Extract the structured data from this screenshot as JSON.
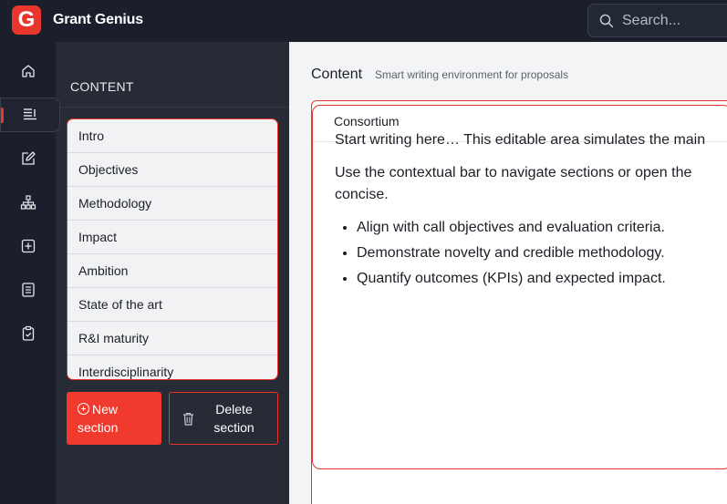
{
  "app": {
    "name": "Grant Genius",
    "logo_letter": "G"
  },
  "search": {
    "placeholder": "Search..."
  },
  "rail": {
    "items": [
      {
        "icon": "home-icon"
      },
      {
        "icon": "content-icon",
        "active": true
      },
      {
        "icon": "edit-icon"
      },
      {
        "icon": "org-chart-icon"
      },
      {
        "icon": "add-box-icon"
      },
      {
        "icon": "document-list-icon"
      },
      {
        "icon": "clipboard-check-icon"
      }
    ]
  },
  "panel": {
    "title": "CONTENT",
    "sections": [
      "Intro",
      "Objectives",
      "Methodology",
      "Impact",
      "Ambition",
      "State of the art",
      "R&I maturity",
      "Interdisciplinarity"
    ],
    "new_button": {
      "line1": "New",
      "line2": "section"
    },
    "delete_button": {
      "line1": "Delete",
      "line2": "section"
    }
  },
  "main": {
    "title": "Content",
    "subtitle": "Smart writing environment for proposals",
    "card_title": "Consortium",
    "editor": {
      "p1": "Start writing here… This editable area simulates the main",
      "p2_line1": "Use the contextual bar to navigate sections or open the",
      "p2_line2": "concise.",
      "bullets": [
        "Align with call objectives and evaluation criteria.",
        "Demonstrate novelty and credible methodology.",
        "Quantify outcomes (KPIs) and expected impact."
      ]
    }
  },
  "colors": {
    "accent": "#e8362c",
    "topbar": "#1a1f2b",
    "panel": "#262b36"
  }
}
